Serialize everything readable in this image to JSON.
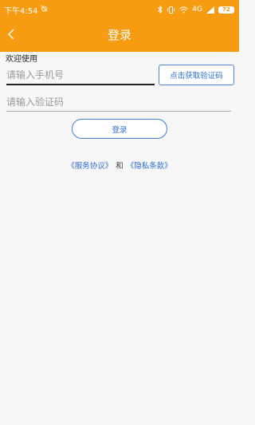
{
  "status_bar": {
    "time": "下午4:54",
    "network": "4G",
    "battery": "72",
    "icons": [
      "alarm-off-icon",
      "bluetooth-icon",
      "vibrate-icon",
      "wifi-icon",
      "signal-icon",
      "battery-icon"
    ]
  },
  "header": {
    "title": "登录",
    "back_icon": "chevron-left-icon",
    "color": "#f79b10"
  },
  "form": {
    "welcome": "欢迎使用",
    "phone_placeholder": "请输入手机号",
    "phone_value": "",
    "code_placeholder": "请输入验证码",
    "code_value": "",
    "get_code_label": "点击获取验证码",
    "login_label": "登录"
  },
  "agreement": {
    "service": "《服务协议》",
    "and": "和",
    "privacy": "《隐私条款》",
    "link_color": "#2f6fcf"
  }
}
